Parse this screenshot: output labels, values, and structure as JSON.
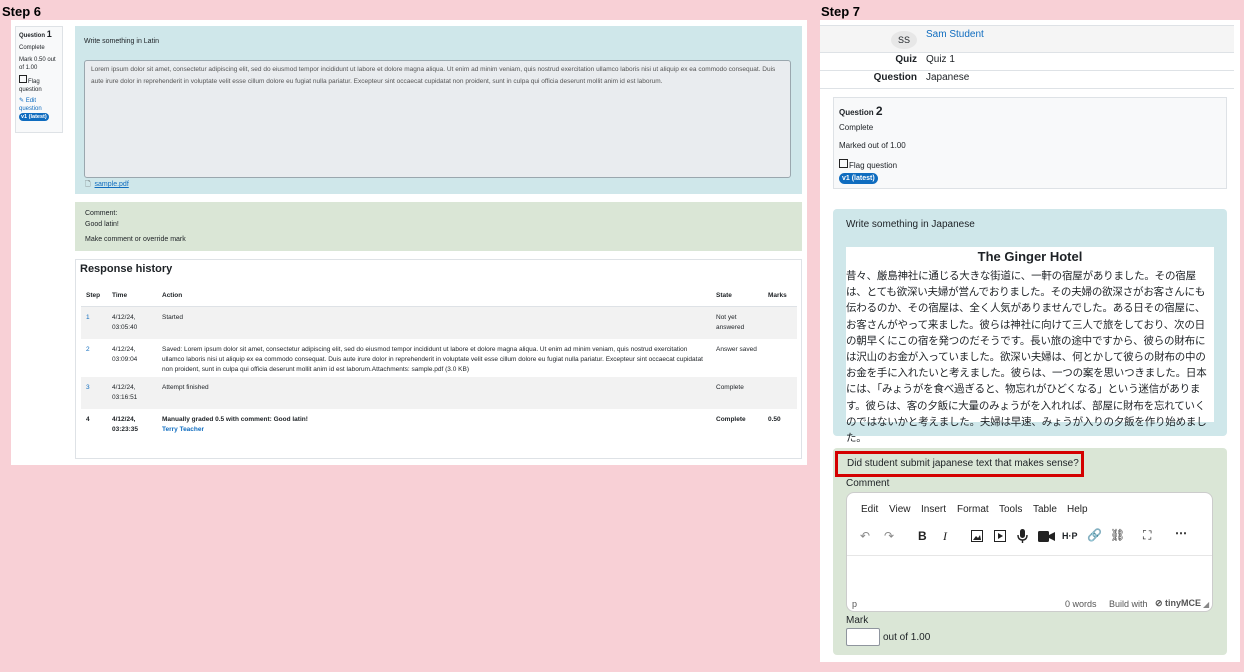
{
  "step6": {
    "label": "Step 6",
    "qinfo": {
      "question_word": "Question",
      "number": "1",
      "state": "Complete",
      "mark": "Mark 0.50 out of 1.00",
      "flag": "Flag question",
      "edit": "Edit question",
      "version": "v1 (latest)"
    },
    "prompt": "Write something in Latin",
    "answer_text": "Lorem ipsum dolor sit amet, consectetur adipiscing elit, sed do eiusmod tempor incididunt ut labore et dolore magna aliqua. Ut enim ad minim veniam, quis nostrud exercitation ullamco laboris nisi ut aliquip ex ea commodo consequat. Duis aute irure dolor in reprehenderit in voluptate velit esse cillum dolore eu fugiat nulla pariatur. Excepteur sint occaecat cupidatat non proident, sunt in culpa qui officia deserunt mollit anim id est laborum.",
    "attachment": "sample.pdf",
    "comment_label": "Comment:",
    "comment_text": "Good latin!",
    "override_link": "Make comment or override mark",
    "history": {
      "title": "Response history",
      "headers": [
        "Step",
        "Time",
        "Action",
        "State",
        "Marks"
      ],
      "rows": [
        {
          "step": "1",
          "time": "4/12/24, 03:05:40",
          "action": "Started",
          "state": "Not yet answered",
          "marks": ""
        },
        {
          "step": "2",
          "time": "4/12/24, 03:09:04",
          "action": "Saved: Lorem ipsum dolor sit amet, consectetur adipiscing elit, sed do eiusmod tempor incididunt ut labore et dolore magna aliqua. Ut enim ad minim veniam, quis nostrud exercitation ullamco laboris nisi ut aliquip ex ea commodo consequat. Duis aute irure dolor in reprehenderit in voluptate velit esse cillum dolore eu fugiat nulla pariatur. Excepteur sint occaecat cupidatat non proident, sunt in culpa qui officia deserunt mollit anim id est laborum.Attachments: sample.pdf (3.0 KB)",
          "state": "Answer saved",
          "marks": ""
        },
        {
          "step": "3",
          "time": "4/12/24, 03:16:51",
          "action": "Attempt finished",
          "state": "Complete",
          "marks": ""
        },
        {
          "step": "4",
          "time": "4/12/24, 03:23:35",
          "action": "Manually graded 0.5 with comment: Good latin!",
          "action_user": "Terry Teacher",
          "state": "Complete",
          "marks": "0.50"
        }
      ]
    }
  },
  "step7": {
    "label": "Step 7",
    "avatar_initials": "SS",
    "student_name": "Sam Student",
    "quiz_label": "Quiz",
    "quiz_value": "Quiz 1",
    "question_label": "Question",
    "question_value": "Japanese",
    "qinfo": {
      "question_word": "Question",
      "number": "2",
      "state": "Complete",
      "marked": "Marked out of 1.00",
      "flag": "Flag question",
      "version": "v1 (latest)"
    },
    "prompt": "Write something in Japanese",
    "doc_title": "The Ginger Hotel",
    "doc_body": "昔々、厳島神社に通じる大きな街道に、一軒の宿屋がありました。その宿屋は、とても欲深い夫婦が営んでおりました。その夫婦の欲深さがお客さんにも伝わるのか、その宿屋は、全く人気がありませんでした。ある日その宿屋に、お客さんがやって来ました。彼らは神社に向けて三人で旅をしており、次の日の朝早くにこの宿を発つのだそうです。長い旅の途中ですから、彼らの財布には沢山のお金が入っていました。欲深い夫婦は、何とかして彼らの財布の中のお金を手に入れたいと考えました。彼らは、一つの案を思いつきました。日本には、「みょうがを食べ過ぎると、物忘れがひどくなる」という迷信があります。彼らは、客の夕飯に大量のみょうがを入れれば、部屋に財布を忘れていくのではないかと考えました。夫婦は早速、みょうが入りの夕飯を作り始めました。",
    "grading_question": "Did student submit japanese text that makes sense?",
    "comment_label": "Comment",
    "editor_menu": [
      "Edit",
      "View",
      "Insert",
      "Format",
      "Tools",
      "Table",
      "Help"
    ],
    "status_path": "p",
    "word_count": "0 words",
    "built_with": "Build with",
    "tiny_brand": "tinyMCE",
    "mark_label": "Mark",
    "out_of": "out of 1.00"
  }
}
